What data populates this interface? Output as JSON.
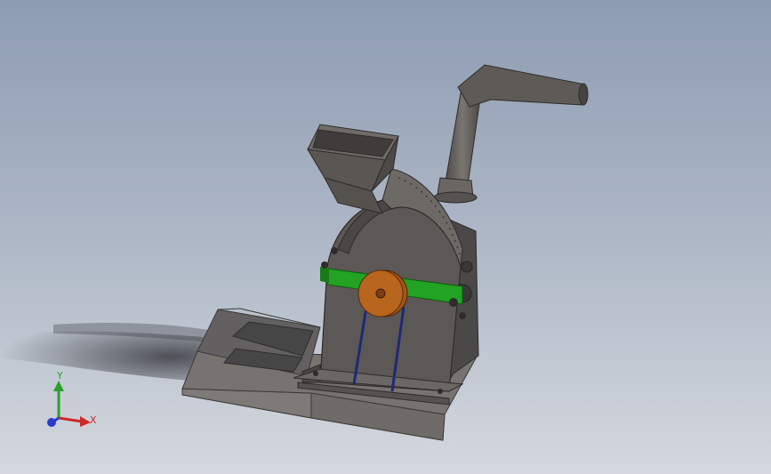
{
  "viewport": {
    "background_top": "#8e9cb2",
    "background_bottom": "#d4d8de"
  },
  "model": {
    "colors": {
      "body": "#5a5754",
      "body_dark": "#3d3b39",
      "body_light": "#77736e",
      "base": "#6b6966",
      "base_light": "#8a8784",
      "band": "#1fa020",
      "pulley": "#b8651e",
      "rods": "#1d2a78"
    }
  },
  "triad": {
    "x_label": "X",
    "y_label": "Y",
    "x_color": "#cc2a2a",
    "y_color": "#2aa02a",
    "z_color": "#2a3acc"
  }
}
